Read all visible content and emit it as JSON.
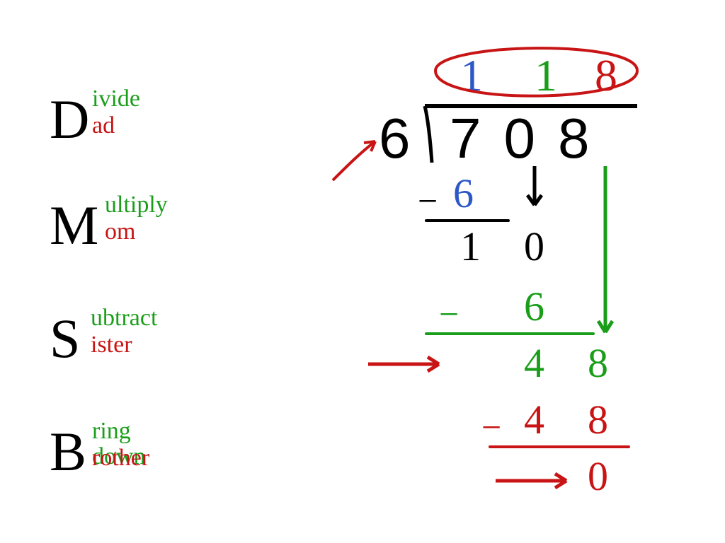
{
  "mnemonic": {
    "d": {
      "letter": "D",
      "top": "ivide",
      "bottom": "ad"
    },
    "m": {
      "letter": "M",
      "top": "ultiply",
      "bottom": "om"
    },
    "s": {
      "letter": "S",
      "top": "ubtract",
      "bottom": "ister"
    },
    "b": {
      "letter": "B",
      "top": "ring down",
      "bottom": "rother"
    }
  },
  "problem": {
    "divisor": "6",
    "dividend": "708",
    "quotient": {
      "d1": "1",
      "d2": "1",
      "d3": "8"
    },
    "step1": {
      "minus": "−",
      "six": "6"
    },
    "step1_result": {
      "one": "1",
      "zero": "0"
    },
    "step2": {
      "minus": "−",
      "six": "6"
    },
    "step2_result": {
      "four": "4",
      "eight": "8"
    },
    "step3": {
      "minus": "−",
      "four": "4",
      "eight": "8"
    },
    "remainder": "0"
  }
}
